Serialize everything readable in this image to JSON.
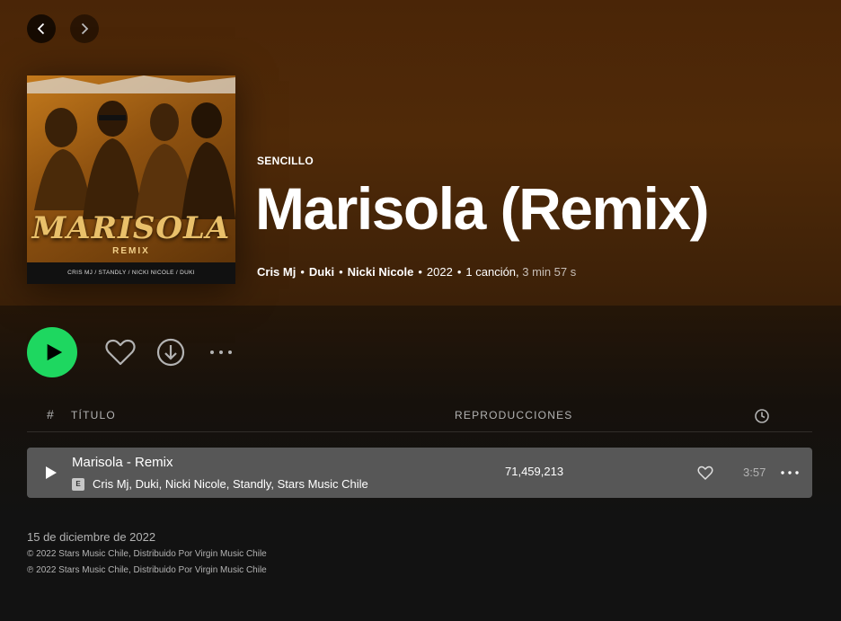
{
  "nav": {
    "back": "chevron-left-icon",
    "forward": "chevron-right-icon"
  },
  "album": {
    "type_label": "SENCILLO",
    "title": "Marisola (Remix)",
    "artists": [
      "Cris Mj",
      "Duki",
      "Nicki Nicole"
    ],
    "year": "2022",
    "song_count": "1 canción",
    "duration": "3 min 57 s",
    "cover": {
      "logo_text": "MARISOLA",
      "sub_text": "REMIX",
      "credits": "CRIS MJ / STANDLY / NICKI NICOLE / DUKI"
    }
  },
  "actions": {
    "play_icon": "play-icon",
    "like_icon": "heart-icon",
    "download_icon": "download-icon",
    "more_icon": "more-icon"
  },
  "table": {
    "headers": {
      "num": "#",
      "title": "TÍTULO",
      "plays": "REPRODUCCIONES",
      "duration_icon": "clock-icon"
    },
    "rows": [
      {
        "title": "Marisola - Remix",
        "explicit": "E",
        "artists": "Cris Mj, Duki, Nicki Nicole, Standly, Stars Music Chile",
        "plays": "71,459,213",
        "duration": "3:57"
      }
    ]
  },
  "footer": {
    "release_date": "15 de diciembre de 2022",
    "copyright": "© 2022 Stars Music Chile, Distribuido Por Virgin Music Chile",
    "phonogram": "℗ 2022 Stars Music Chile, Distribuido Por Virgin Music Chile"
  },
  "colors": {
    "accent": "#1ed760",
    "hero": "#4a2507",
    "background": "#121212",
    "row_hover": "#575757"
  }
}
